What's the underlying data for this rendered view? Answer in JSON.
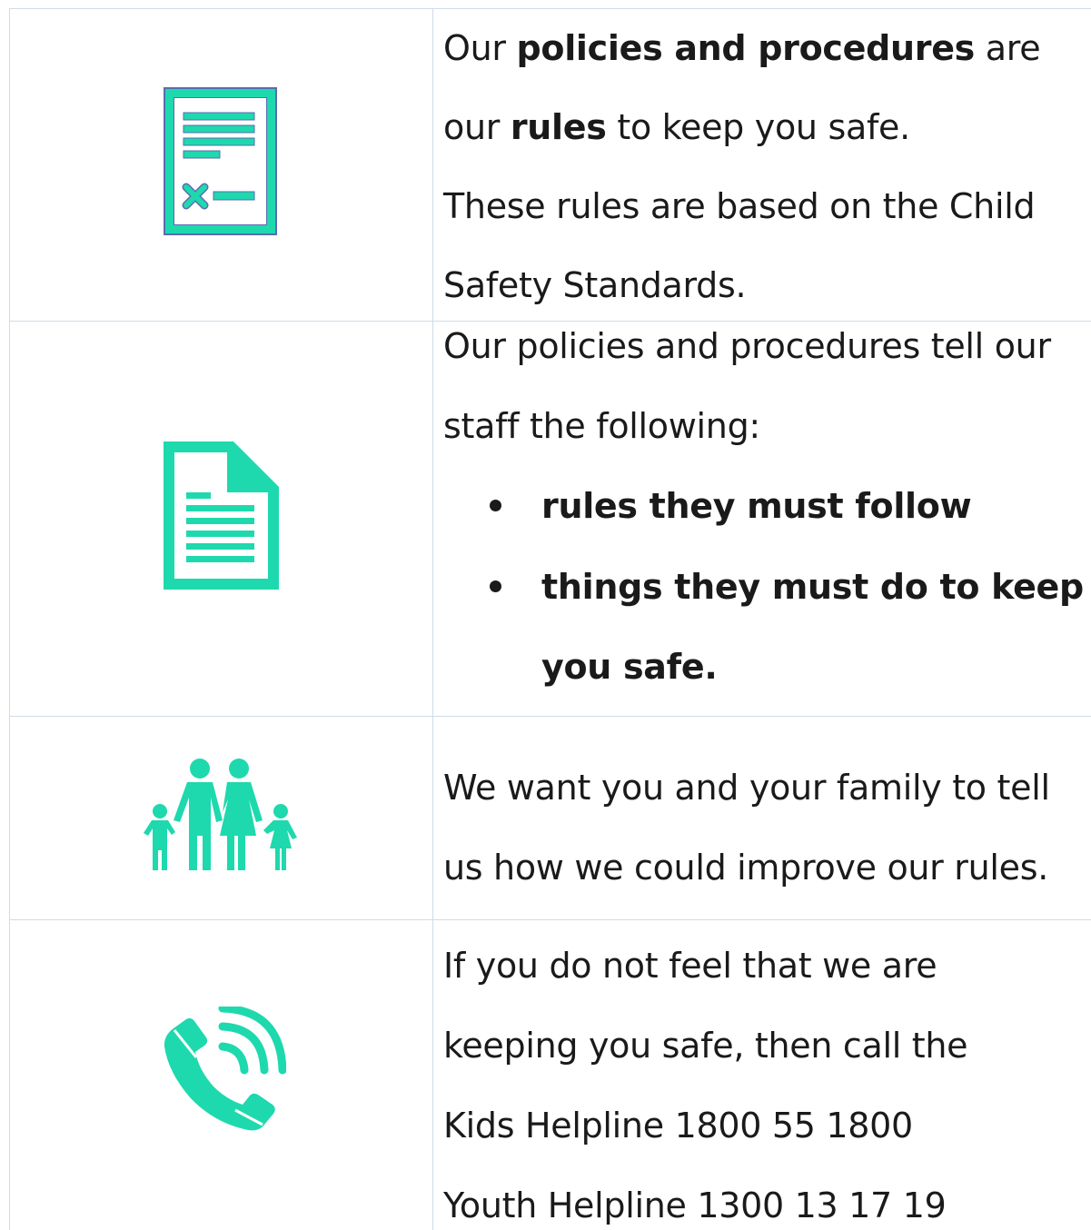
{
  "colors": {
    "accent": "#1ed9ad",
    "border": "#cfdcea",
    "icon_outline": "#5b6bb0"
  },
  "rows": [
    {
      "icon": "document-checklist-icon",
      "lines": [
        {
          "a": "Our ",
          "b": "policies and procedures",
          "c": " are"
        },
        {
          "a": "our ",
          "b": "rules",
          "c": " to keep you safe."
        },
        {
          "a": "These rules are based on the Child"
        },
        {
          "a": "Safety Standards."
        }
      ]
    },
    {
      "icon": "document-page-icon",
      "lines": [
        {
          "a": "Our policies and procedures tell our"
        },
        {
          "a": "staff the following:"
        }
      ],
      "bullets": [
        {
          "lines": [
            "rules they must follow"
          ]
        },
        {
          "lines": [
            "things they must do to keep",
            "you safe."
          ]
        }
      ]
    },
    {
      "icon": "family-icon",
      "lines": [
        {
          "a": "We want you and your family to tell"
        },
        {
          "a": "us how we could improve our rules."
        }
      ]
    },
    {
      "icon": "phone-call-icon",
      "lines": [
        {
          "a": "If you do not feel that we are"
        },
        {
          "a": "keeping you safe, then call the"
        },
        {
          "a": "Kids Helpline 1800 55 1800"
        },
        {
          "a": "Youth Helpline 1300 13 17 19"
        }
      ]
    }
  ]
}
